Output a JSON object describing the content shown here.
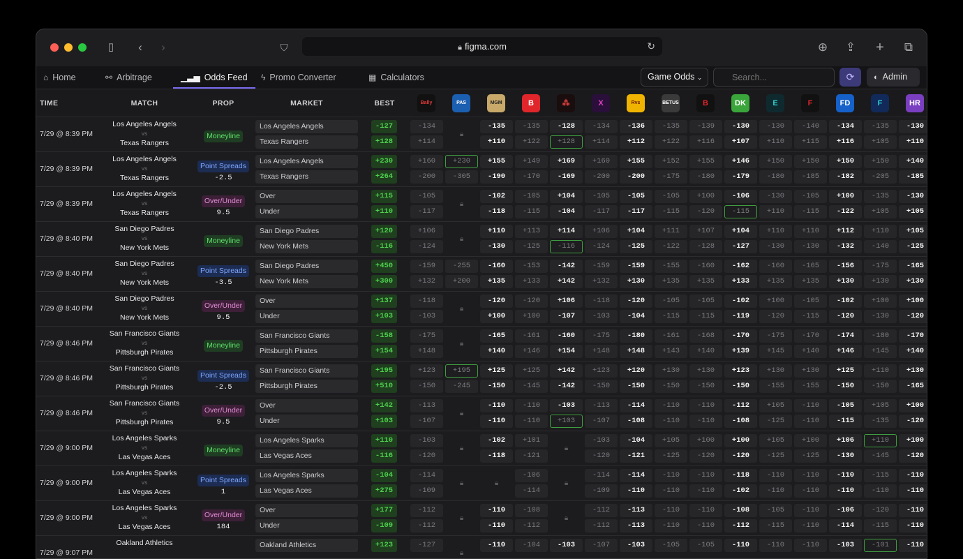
{
  "browser": {
    "url": "figma.com"
  },
  "nav": {
    "tabs": [
      {
        "label": "Home",
        "icon": "home-icon"
      },
      {
        "label": "Arbitrage",
        "icon": "arbitrage-icon"
      },
      {
        "label": "Odds Feed",
        "icon": "bar-chart-icon"
      },
      {
        "label": "Promo Converter",
        "icon": "bolt-icon"
      },
      {
        "label": "Calculators",
        "icon": "calculator-icon"
      }
    ],
    "active": "Odds Feed",
    "game_odds": "Game Odds",
    "search_placeholder": "Search...",
    "admin": "Admin"
  },
  "columns": {
    "time": "TIME",
    "match": "MATCH",
    "prop": "PROP",
    "market": "MARKET",
    "best": "BEST ODDS"
  },
  "books": [
    {
      "t": "Bally",
      "bg": "#111",
      "c": "#e03a3a"
    },
    {
      "t": "PAS",
      "bg": "#1b5fb0",
      "c": "#fff"
    },
    {
      "t": "MGM",
      "bg": "#c8a96a",
      "c": "#222"
    },
    {
      "t": "B",
      "bg": "#e0262b",
      "c": "#fff"
    },
    {
      "t": "⁂",
      "bg": "#1a0d0d",
      "c": "#e04040"
    },
    {
      "t": "X",
      "bg": "#2a0f3a",
      "c": "#e040c0"
    },
    {
      "t": "Rvs",
      "bg": "#f0b400",
      "c": "#6a1a00"
    },
    {
      "t": "BETUS",
      "bg": "#3a3a3a",
      "c": "#fff"
    },
    {
      "t": "B",
      "bg": "#111",
      "c": "#e0262b"
    },
    {
      "t": "DK",
      "bg": "#3aa53a",
      "c": "#fff"
    },
    {
      "t": "E",
      "bg": "#0f2a2f",
      "c": "#2fd0d0"
    },
    {
      "t": "F",
      "bg": "#111",
      "c": "#e0262b"
    },
    {
      "t": "FD",
      "bg": "#1561c9",
      "c": "#fff"
    },
    {
      "t": "F",
      "bg": "#112a5a",
      "c": "#2fd0d0"
    },
    {
      "t": "HR",
      "bg": "#7a3fc0",
      "c": "#fff"
    }
  ],
  "rows": [
    {
      "time": "7/29 @ 8:39 PM",
      "home": "Los Angeles Angels",
      "away": "Texas Rangers",
      "prop": "Moneyline",
      "line": "",
      "t": "ml",
      "m1": "Los Angeles Angels",
      "m2": "Texas Rangers",
      "b1": "-127",
      "b2": "+128",
      "o1": [
        "-134",
        "L",
        "-135",
        "-135",
        "-128",
        "-134",
        "-136",
        "-135",
        "-139",
        "-130",
        "-130",
        "-140",
        "-134",
        "-135",
        "-130"
      ],
      "o2": [
        "+114",
        "L",
        "+110",
        "+122",
        "+128",
        "+114",
        "+112",
        "+122",
        "+116",
        "+107",
        "+110",
        "+115",
        "+116",
        "+105",
        "+110"
      ]
    },
    {
      "time": "7/29 @ 8:39 PM",
      "home": "Los Angeles Angels",
      "away": "Texas Rangers",
      "prop": "Point Spreads",
      "line": "-2.5",
      "t": "ps",
      "m1": "Los Angeles Angels",
      "m2": "Texas Rangers",
      "b1": "+230",
      "b2": "+264",
      "o1": [
        "+160",
        "+230",
        "+155",
        "+149",
        "+169",
        "+160",
        "+155",
        "+152",
        "+155",
        "+146",
        "+150",
        "+150",
        "+150",
        "+150",
        "+140"
      ],
      "o2": [
        "-200",
        "-305",
        "-190",
        "-170",
        "-169",
        "-200",
        "-200",
        "-175",
        "-180",
        "-179",
        "-180",
        "-185",
        "-182",
        "-205",
        "-185"
      ]
    },
    {
      "time": "7/29 @ 8:39 PM",
      "home": "Los Angeles Angels",
      "away": "Texas Rangers",
      "prop": "Over/Under",
      "line": "9.5",
      "t": "ou",
      "m1": "Over",
      "m2": "Under",
      "b1": "+115",
      "b2": "+110",
      "o1": [
        "-105",
        "L",
        "-102",
        "-105",
        "+104",
        "-105",
        "-105",
        "-105",
        "+100",
        "-106",
        "-130",
        "-105",
        "+100",
        "-135",
        "-130"
      ],
      "o2": [
        "-117",
        "L",
        "-118",
        "-115",
        "-104",
        "-117",
        "-117",
        "-115",
        "-120",
        "-115",
        "+110",
        "-115",
        "-122",
        "+105",
        "+105"
      ]
    },
    {
      "time": "7/29 @ 8:40 PM",
      "home": "San Diego Padres",
      "away": "New York Mets",
      "prop": "Moneyline",
      "line": "",
      "t": "ml",
      "m1": "San Diego Padres",
      "m2": "New York Mets",
      "b1": "+120",
      "b2": "-116",
      "o1": [
        "+106",
        "L",
        "+110",
        "+113",
        "+114",
        "+106",
        "+104",
        "+111",
        "+107",
        "+104",
        "+110",
        "+110",
        "+112",
        "+110",
        "+105"
      ],
      "o2": [
        "-124",
        "L",
        "-130",
        "-125",
        "-116",
        "-124",
        "-125",
        "-122",
        "-128",
        "-127",
        "-130",
        "-130",
        "-132",
        "-140",
        "-125"
      ]
    },
    {
      "time": "7/29 @ 8:40 PM",
      "home": "San Diego Padres",
      "away": "New York Mets",
      "prop": "Point Spreads",
      "line": "-3.5",
      "t": "ps",
      "m1": "San Diego Padres",
      "m2": "New York Mets",
      "b1": "+450",
      "b2": "+300",
      "o1": [
        "-159",
        "-255",
        "-160",
        "-153",
        "-142",
        "-159",
        "-159",
        "-155",
        "-160",
        "-162",
        "-160",
        "-165",
        "-156",
        "-175",
        "-165"
      ],
      "o2": [
        "+132",
        "+200",
        "+135",
        "+133",
        "+142",
        "+132",
        "+130",
        "+135",
        "+135",
        "+133",
        "+135",
        "+135",
        "+130",
        "+130",
        "+130"
      ]
    },
    {
      "time": "7/29 @ 8:40 PM",
      "home": "San Diego Padres",
      "away": "New York Mets",
      "prop": "Over/Under",
      "line": "9.5",
      "t": "ou",
      "m1": "Over",
      "m2": "Under",
      "b1": "+137",
      "b2": "+103",
      "o1": [
        "-118",
        "L",
        "-120",
        "-120",
        "+106",
        "-118",
        "-120",
        "-105",
        "-105",
        "-102",
        "+100",
        "-105",
        "-102",
        "+100",
        "+100"
      ],
      "o2": [
        "-103",
        "L",
        "+100",
        "+100",
        "-107",
        "-103",
        "-104",
        "-115",
        "-115",
        "-119",
        "-120",
        "-115",
        "-120",
        "-130",
        "-120"
      ]
    },
    {
      "time": "7/29 @ 8:46 PM",
      "home": "San Francisco Giants",
      "away": "Pittsburgh Pirates",
      "prop": "Moneyline",
      "line": "",
      "t": "ml",
      "m1": "San Francisco Giants",
      "m2": "Pittsburgh Pirates",
      "b1": "-158",
      "b2": "+154",
      "o1": [
        "-175",
        "L",
        "-165",
        "-161",
        "-160",
        "-175",
        "-180",
        "-161",
        "-168",
        "-170",
        "-175",
        "-170",
        "-174",
        "-180",
        "-170"
      ],
      "o2": [
        "+148",
        "L",
        "+140",
        "+146",
        "+154",
        "+148",
        "+148",
        "+143",
        "+140",
        "+139",
        "+145",
        "+140",
        "+146",
        "+145",
        "+140"
      ]
    },
    {
      "time": "7/29 @ 8:46 PM",
      "home": "San Francisco Giants",
      "away": "Pittsburgh Pirates",
      "prop": "Point Spreads",
      "line": "-2.5",
      "t": "ps",
      "m1": "San Francisco Giants",
      "m2": "Pittsburgh Pirates",
      "b1": "+195",
      "b2": "+510",
      "o1": [
        "+123",
        "+195",
        "+125",
        "+125",
        "+142",
        "+123",
        "+120",
        "+130",
        "+130",
        "+123",
        "+130",
        "+130",
        "+125",
        "+110",
        "+130"
      ],
      "o2": [
        "-150",
        "-245",
        "-150",
        "-145",
        "-142",
        "-150",
        "-150",
        "-150",
        "-150",
        "-150",
        "-155",
        "-155",
        "-150",
        "-150",
        "-165"
      ]
    },
    {
      "time": "7/29 @ 8:46 PM",
      "home": "San Francisco Giants",
      "away": "Pittsburgh Pirates",
      "prop": "Over/Under",
      "line": "9.5",
      "t": "ou",
      "m1": "Over",
      "m2": "Under",
      "b1": "+142",
      "b2": "+103",
      "o1": [
        "-113",
        "L",
        "-110",
        "-110",
        "-103",
        "-113",
        "-114",
        "-110",
        "-110",
        "-112",
        "+105",
        "-110",
        "-105",
        "+105",
        "+100"
      ],
      "o2": [
        "-107",
        "L",
        "-110",
        "-110",
        "+103",
        "-107",
        "-108",
        "-110",
        "-110",
        "-108",
        "-125",
        "-110",
        "-115",
        "-135",
        "-120"
      ]
    },
    {
      "time": "7/29 @ 9:00 PM",
      "home": "Los Angeles Sparks",
      "away": "Las Vegas Aces",
      "prop": "Moneyline",
      "line": "",
      "t": "ml",
      "m1": "Los Angeles Sparks",
      "m2": "Las Vegas Aces",
      "b1": "+110",
      "b2": "-116",
      "o1": [
        "-103",
        "L",
        "-102",
        "+101",
        "L",
        "-103",
        "-104",
        "+105",
        "+100",
        "+100",
        "+105",
        "+100",
        "+106",
        "+110",
        "+100"
      ],
      "o2": [
        "-120",
        "L",
        "-118",
        "-121",
        "L",
        "-120",
        "-121",
        "-125",
        "-120",
        "-120",
        "-125",
        "-125",
        "-130",
        "-145",
        "-120"
      ]
    },
    {
      "time": "7/29 @ 9:00 PM",
      "home": "Los Angeles Sparks",
      "away": "Las Vegas Aces",
      "prop": "Point Spreads",
      "line": "1",
      "t": "ps",
      "m1": "Los Angeles Sparks",
      "m2": "Las Vegas Aces",
      "b1": "-104",
      "b2": "+275",
      "o1": [
        "-114",
        "L",
        "L",
        "-106",
        "L",
        "-114",
        "-114",
        "-110",
        "-110",
        "-118",
        "-110",
        "-110",
        "-110",
        "-115",
        "-110"
      ],
      "o2": [
        "-109",
        "L",
        "L",
        "-114",
        "L",
        "-109",
        "-110",
        "-110",
        "-110",
        "-102",
        "-110",
        "-110",
        "-110",
        "-110",
        "-110"
      ]
    },
    {
      "time": "7/29 @ 9:00 PM",
      "home": "Los Angeles Sparks",
      "away": "Las Vegas Aces",
      "prop": "Over/Under",
      "line": "184",
      "t": "ou",
      "m1": "Over",
      "m2": "Under",
      "b1": "+177",
      "b2": "-109",
      "o1": [
        "-112",
        "L",
        "-110",
        "-108",
        "L",
        "-112",
        "-113",
        "-110",
        "-110",
        "-108",
        "-105",
        "-110",
        "-106",
        "-120",
        "-110"
      ],
      "o2": [
        "-112",
        "L",
        "-110",
        "-112",
        "L",
        "-112",
        "-113",
        "-110",
        "-110",
        "-112",
        "-115",
        "-110",
        "-114",
        "-115",
        "-110"
      ]
    },
    {
      "time": "7/29 @ 9:07 PM",
      "home": "Oakland Athletics",
      "away": "",
      "prop": "",
      "line": "",
      "t": "",
      "m1": "Oakland Athletics",
      "m2": "",
      "b1": "+123",
      "b2": "",
      "o1": [
        "-127",
        "L",
        "-110",
        "-104",
        "-103",
        "-107",
        "-103",
        "-105",
        "-105",
        "-110",
        "-110",
        "-110",
        "-103",
        "-101",
        "-110"
      ],
      "o2": []
    }
  ]
}
